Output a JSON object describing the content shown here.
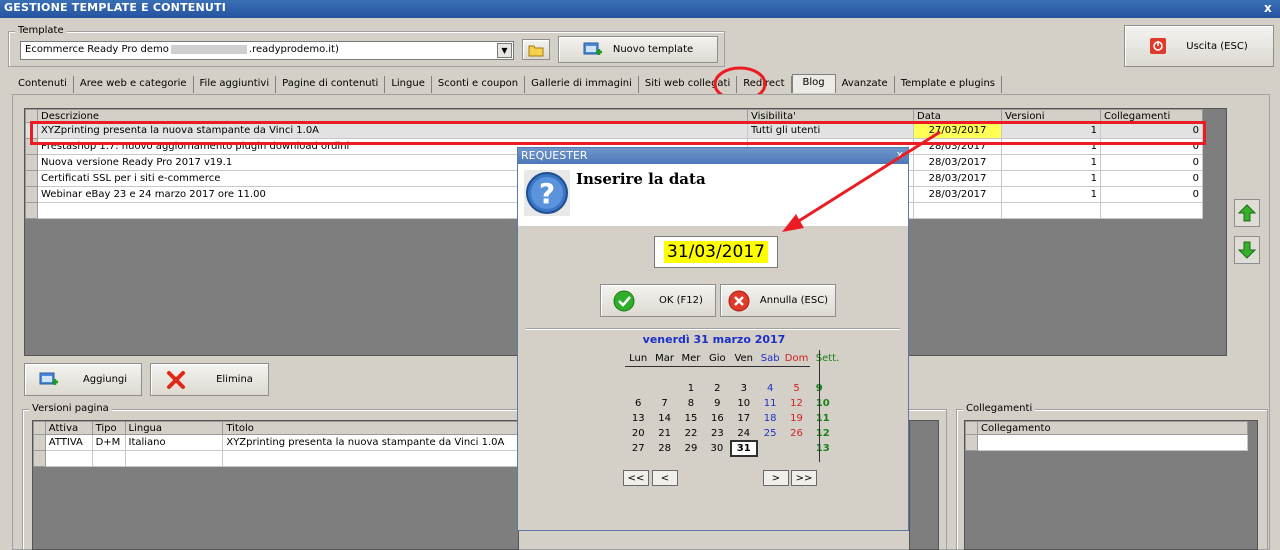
{
  "window": {
    "title": "GESTIONE TEMPLATE E CONTENUTI",
    "close_glyph": "x"
  },
  "template_group": {
    "label": "Template",
    "selected_prefix": "Ecommerce Ready Pro demo",
    "selected_suffix": ".readyprodemo.it)",
    "new_template_label": "Nuovo template"
  },
  "exit_button": {
    "label": "Uscita (ESC)"
  },
  "tabs": [
    {
      "label": "Contenuti"
    },
    {
      "label": "Aree web e categorie"
    },
    {
      "label": "File aggiuntivi"
    },
    {
      "label": "Pagine di contenuti"
    },
    {
      "label": "Lingue"
    },
    {
      "label": "Sconti e coupon"
    },
    {
      "label": "Gallerie di immagini"
    },
    {
      "label": "Siti web collegati"
    },
    {
      "label": "Redirect"
    },
    {
      "label": "Blog"
    },
    {
      "label": "Avanzate"
    },
    {
      "label": "Template e plugins"
    }
  ],
  "active_tab": "Blog",
  "blog_table": {
    "columns": [
      "Descrizione",
      "Visibilita'",
      "Data",
      "Versioni",
      "Collegamenti"
    ],
    "rows": [
      [
        "XYZprinting presenta la nuova stampante da Vinci 1.0A",
        "Tutti gli utenti",
        "27/03/2017",
        "1",
        "0"
      ],
      [
        "Prestashop 1.7: nuovo aggiornamento plugin download ordini",
        "",
        "28/03/2017",
        "1",
        "0"
      ],
      [
        "Nuova versione Ready Pro 2017 v19.1",
        "",
        "28/03/2017",
        "1",
        "0"
      ],
      [
        "Certificati SSL per i siti e-commerce",
        "",
        "28/03/2017",
        "1",
        "0"
      ],
      [
        "Webinar eBay 23 e 24 marzo 2017 ore 11.00",
        "",
        "28/03/2017",
        "1",
        "0"
      ]
    ]
  },
  "actions": {
    "add_label": "Aggiungi",
    "delete_label": "Elimina"
  },
  "versions": {
    "label": "Versioni pagina",
    "columns": [
      "Attiva",
      "Tipo",
      "Lingua",
      "Titolo"
    ],
    "rows": [
      [
        "ATTIVA",
        "D+M",
        "Italiano",
        "XYZprinting presenta la nuova stampante da Vinci 1.0A"
      ]
    ]
  },
  "links": {
    "label": "Collegamenti",
    "columns": [
      "Collegamento"
    ]
  },
  "requester": {
    "title": "REQUESTER",
    "close_glyph": "x",
    "message": "Inserire la data",
    "date_value": "31/03/2017",
    "ok_label": "OK (F12)",
    "cancel_label": "Annulla (ESC)",
    "calendar": {
      "header": "venerdì 31 marzo 2017",
      "days": [
        "Lun",
        "Mar",
        "Mer",
        "Gio",
        "Ven",
        "Sab",
        "Dom"
      ],
      "week_label": "Sett.",
      "weeks": [
        {
          "n": "9",
          "d": [
            "",
            "",
            "1",
            "2",
            "3",
            "4",
            "5"
          ]
        },
        {
          "n": "10",
          "d": [
            "6",
            "7",
            "8",
            "9",
            "10",
            "11",
            "12"
          ]
        },
        {
          "n": "11",
          "d": [
            "13",
            "14",
            "15",
            "16",
            "17",
            "18",
            "19"
          ]
        },
        {
          "n": "12",
          "d": [
            "20",
            "21",
            "22",
            "23",
            "24",
            "25",
            "26"
          ]
        },
        {
          "n": "13",
          "d": [
            "27",
            "28",
            "29",
            "30",
            "31",
            "",
            ""
          ]
        }
      ],
      "selected_day": "31",
      "nav": {
        "first": "<<",
        "prev": "<",
        "next": ">",
        "last": ">>"
      }
    }
  },
  "colors": {
    "highlight": "#ec1c24",
    "date_highlight": "#ffff00",
    "calendar_blue": "#1a30c8",
    "week_green": "#188018"
  }
}
